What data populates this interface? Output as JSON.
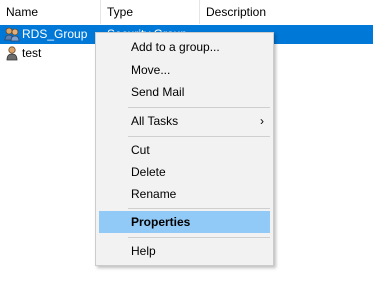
{
  "columns": {
    "name": "Name",
    "type": "Type",
    "description": "Description"
  },
  "rows": [
    {
      "name": "RDS_Group",
      "type": "Security Group",
      "icon": "group-icon",
      "selected": true
    },
    {
      "name": "test",
      "type": "",
      "icon": "user-icon",
      "selected": false
    }
  ],
  "menu": {
    "add_to_group": "Add to a group...",
    "move": "Move...",
    "send_mail": "Send Mail",
    "all_tasks": "All Tasks",
    "all_tasks_arrow": "›",
    "cut": "Cut",
    "delete": "Delete",
    "rename": "Rename",
    "properties": "Properties",
    "help": "Help"
  },
  "colors": {
    "selection": "#0078d7",
    "menu_highlight": "#91c9f7",
    "menu_bg": "#f2f2f2"
  }
}
